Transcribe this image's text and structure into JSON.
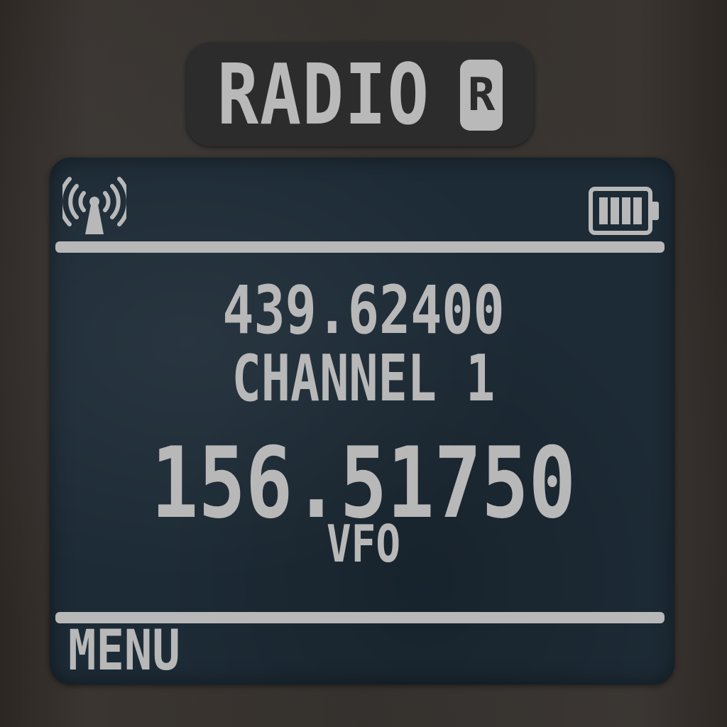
{
  "title": {
    "text": "RADIO",
    "badge": "R"
  },
  "status": {
    "signal_icon": "antenna-signal-icon",
    "battery_icon": "battery-full-icon",
    "battery_level": 1.0
  },
  "display": {
    "frequency_a": "439.62400",
    "channel": "CHANNEL 1",
    "frequency_b": "156.51750",
    "mode": "VFO"
  },
  "softkeys": {
    "left": "MENU"
  },
  "colors": {
    "screen_bg": "#1d2b36",
    "lcd_text": "#b8b8b8",
    "title_plate": "#2c2c2c"
  }
}
